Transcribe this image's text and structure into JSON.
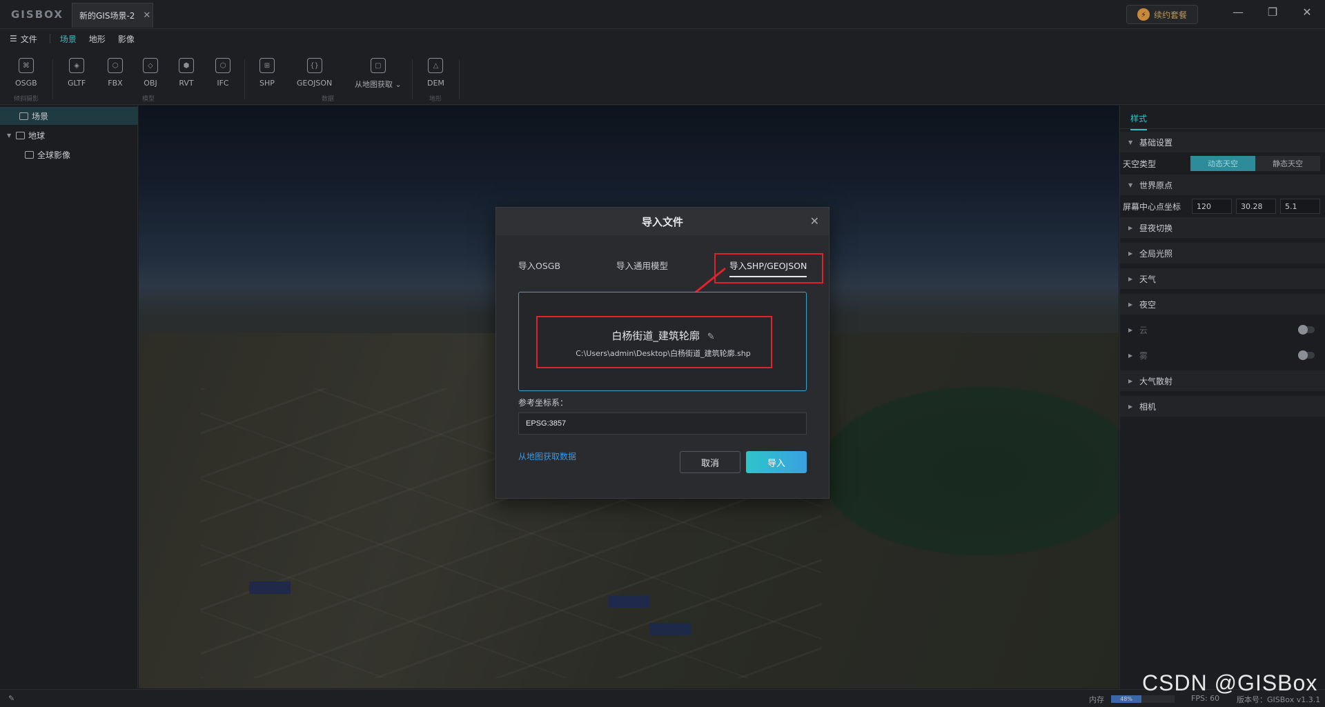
{
  "titlebar": {
    "logo": "GISBOX",
    "doc_tab": "新的GIS场景-2",
    "subscribe": "续约套餐",
    "minimize": "—",
    "maximize": "❐",
    "close": "✕"
  },
  "menubar": {
    "file": "文件",
    "tabs": [
      "场景",
      "地形",
      "影像"
    ]
  },
  "ribbon": {
    "items": [
      {
        "label": "OSGB",
        "glyph": "⌘"
      },
      {
        "label": "GLTF",
        "glyph": "◈"
      },
      {
        "label": "FBX",
        "glyph": "⬡"
      },
      {
        "label": "OBJ",
        "glyph": "◇"
      },
      {
        "label": "RVT",
        "glyph": "⬢"
      },
      {
        "label": "IFC",
        "glyph": "⬡"
      },
      {
        "label": "SHP",
        "glyph": "⊞"
      },
      {
        "label": "GEOJSON",
        "glyph": "{}"
      },
      {
        "label": "从地图获取",
        "glyph": "▢"
      },
      {
        "label": "DEM",
        "glyph": "△"
      }
    ],
    "groups": [
      "倾斜摄影",
      "模型",
      "数据",
      "地形"
    ]
  },
  "tree": {
    "items": [
      "场景",
      "地球",
      "全球影像"
    ]
  },
  "right_panel": {
    "tab": "样式",
    "basic": "基础设置",
    "sky_type_label": "天空类型",
    "sky_dynamic": "动态天空",
    "sky_static": "静态天空",
    "world_origin": "世界原点",
    "center_label": "屏幕中心点坐标",
    "center_values": [
      "120",
      "30.28",
      "5.1"
    ],
    "sections": [
      "昼夜切换",
      "全局光照",
      "天气",
      "夜空"
    ],
    "disabled": [
      "云",
      "雾"
    ],
    "more_sections": [
      "大气散射",
      "相机"
    ]
  },
  "statusbar": {
    "memory_label": "内存",
    "memory_value": "48%",
    "memory_fraction": 0.48,
    "fps": "FPS: 60",
    "version": "版本号：GISBox v1.3.1"
  },
  "modal": {
    "title": "导入文件",
    "close": "✕",
    "tabs": [
      "导入OSGB",
      "导入通用模型",
      "导入SHP/GEOJSON"
    ],
    "file_name": "白杨街道_建筑轮廓",
    "file_path": "C:\\Users\\admin\\Desktop\\白杨街道_建筑轮廓.shp",
    "crs_label": "参考坐标系：",
    "crs_value": "EPSG:3857",
    "map_link": "从地图获取数据",
    "cancel": "取消",
    "import": "导入"
  },
  "watermark": "CSDN @GISBox",
  "colors": {
    "accent": "#2fc3c8",
    "highlight": "#e0232a",
    "link": "#3f96d9"
  }
}
